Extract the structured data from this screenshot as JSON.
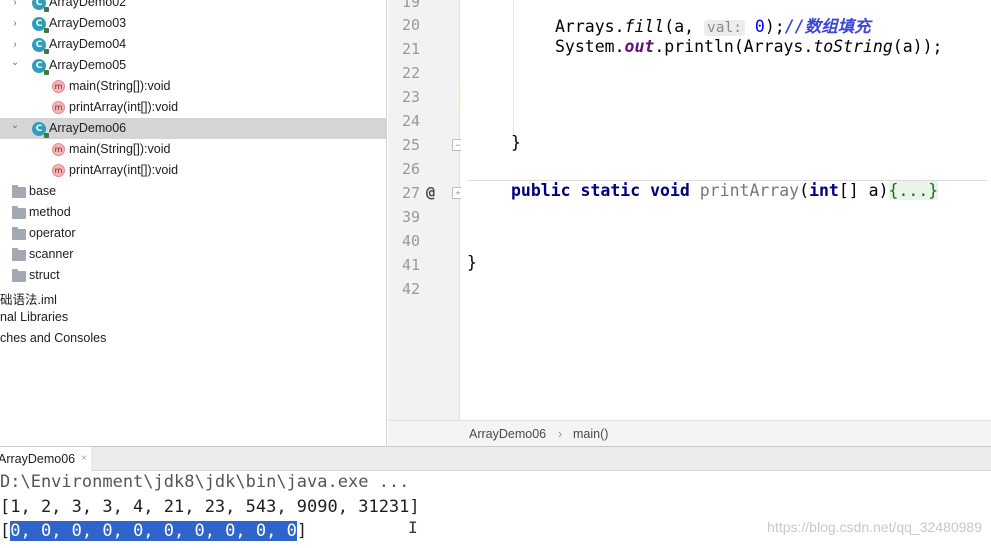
{
  "tree": {
    "items": [
      {
        "label": "ArrayDemo02",
        "kind": "class"
      },
      {
        "label": "ArrayDemo03",
        "kind": "class"
      },
      {
        "label": "ArrayDemo04",
        "kind": "class"
      },
      {
        "label": "ArrayDemo05",
        "kind": "class"
      },
      {
        "label": "main(String[]):void",
        "kind": "method",
        "icon_letter": "m"
      },
      {
        "label": "printArray(int[]):void",
        "kind": "method",
        "icon_letter": "m"
      },
      {
        "label": "ArrayDemo06",
        "kind": "class",
        "selected": true
      },
      {
        "label": "main(String[]):void",
        "kind": "method",
        "icon_letter": "m"
      },
      {
        "label": "printArray(int[]):void",
        "kind": "method",
        "icon_letter": "m"
      },
      {
        "label": "base",
        "kind": "folder"
      },
      {
        "label": "method",
        "kind": "folder"
      },
      {
        "label": "operator",
        "kind": "folder"
      },
      {
        "label": "scanner",
        "kind": "folder"
      },
      {
        "label": "struct",
        "kind": "folder"
      },
      {
        "label": "础语法.iml",
        "kind": "file"
      },
      {
        "label": "nal Libraries",
        "kind": "node"
      },
      {
        "label": "ches and Consoles",
        "kind": "node"
      }
    ],
    "class_icon_letter": "C",
    "expand_arrow_right": "›",
    "expand_arrow_down": "⌄"
  },
  "editor": {
    "line_numbers": [
      "19",
      "20",
      "21",
      "22",
      "23",
      "24",
      "25",
      "26",
      "27",
      "39",
      "40",
      "41",
      "42"
    ],
    "gutter_marker": "@",
    "code": {
      "l20_a": "Arrays.",
      "l20_fill": "fill",
      "l20_b": "(a, ",
      "l20_hint": "val:",
      "l20_zero": "0",
      "l20_c": ");",
      "l20_comment": "//数组填充",
      "l21_a": "System.",
      "l21_out": "out",
      "l21_b": ".println(Arrays.",
      "l21_tostring": "toString",
      "l21_c": "(a));",
      "l25": "}",
      "l27_public": "public",
      "l27_static": "static",
      "l27_void": "void",
      "l27_name": "printArray",
      "l27_paren": "(",
      "l27_int": "int",
      "l27_args": "[] a)",
      "l27_folded": "{...}",
      "l41": "}"
    }
  },
  "breadcrumbs": [
    "ArrayDemo06",
    "main()"
  ],
  "breadcrumb_sep": "›",
  "run": {
    "tab_label": "ArrayDemo06",
    "tab_close": "×",
    "lines": [
      "D:\\Environment\\jdk8\\jdk\\bin\\java.exe ...",
      "[1, 2, 3, 3, 4, 21, 23, 543, 9090, 31231]"
    ],
    "line3_open": "[",
    "line3_selected": "0, 0, 0, 0, 0, 0, 0, 0, 0, 0",
    "line3_close": "]",
    "watermark": "https://blog.csdn.net/qq_32480989"
  },
  "colors": {
    "selection": "#2f65ca",
    "keyword": "#00007f",
    "comment": "#3a47d8",
    "current_line": "#fffbe2"
  }
}
